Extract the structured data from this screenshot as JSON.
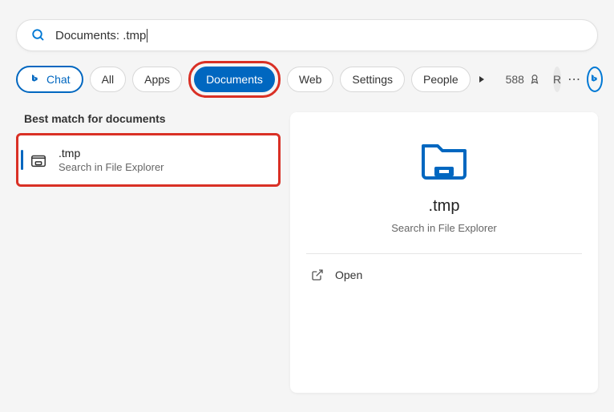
{
  "search": {
    "value": "Documents: .tmp"
  },
  "filters": {
    "chat": "Chat",
    "all": "All",
    "apps": "Apps",
    "documents": "Documents",
    "web": "Web",
    "settings": "Settings",
    "people": "People"
  },
  "rewards": {
    "points": "588"
  },
  "user": {
    "initial": "R"
  },
  "results": {
    "section_title": "Best match for documents",
    "item": {
      "title": ".tmp",
      "subtitle": "Search in File Explorer"
    }
  },
  "preview": {
    "title": ".tmp",
    "subtitle": "Search in File Explorer",
    "actions": {
      "open": "Open"
    }
  }
}
